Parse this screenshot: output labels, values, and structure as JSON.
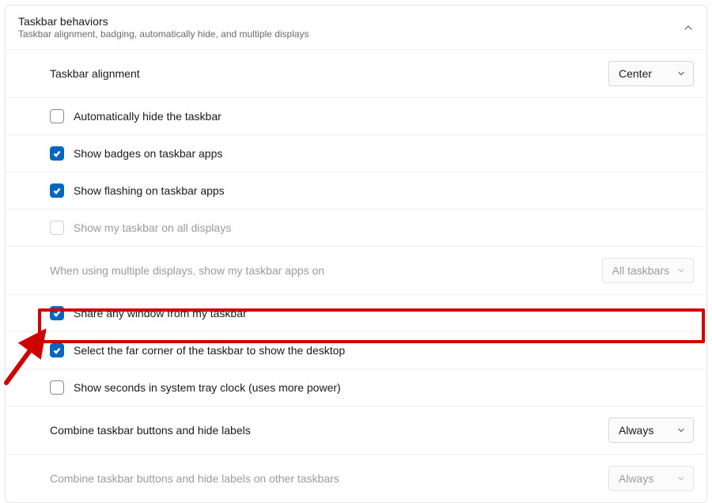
{
  "header": {
    "title": "Taskbar behaviors",
    "subtitle": "Taskbar alignment, badging, automatically hide, and multiple displays"
  },
  "items": {
    "alignment": {
      "label": "Taskbar alignment",
      "value": "Center"
    },
    "autohide": {
      "label": "Automatically hide the taskbar",
      "checked": false
    },
    "badges": {
      "label": "Show badges on taskbar apps",
      "checked": true
    },
    "flashing": {
      "label": "Show flashing on taskbar apps",
      "checked": true
    },
    "alldisplays": {
      "label": "Show my taskbar on all displays",
      "checked": false,
      "disabled": true
    },
    "multidisplaywhere": {
      "label": "When using multiple displays, show my taskbar apps on",
      "value": "All taskbars",
      "disabled": true
    },
    "shareany": {
      "label": "Share any window from my taskbar",
      "checked": true
    },
    "farcorner": {
      "label": "Select the far corner of the taskbar to show the desktop",
      "checked": true
    },
    "showseconds": {
      "label": "Show seconds in system tray clock (uses more power)",
      "checked": false
    },
    "combine": {
      "label": "Combine taskbar buttons and hide labels",
      "value": "Always"
    },
    "combineother": {
      "label": "Combine taskbar buttons and hide labels on other taskbars",
      "value": "Always",
      "disabled": true
    }
  },
  "annotation": {
    "highlight_color": "#d10000"
  }
}
